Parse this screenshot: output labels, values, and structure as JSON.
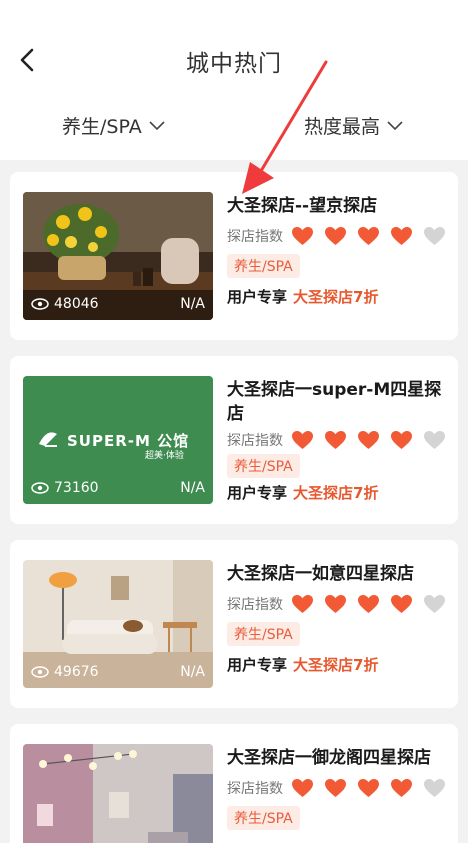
{
  "header": {
    "title": "城中热门"
  },
  "filters": [
    {
      "label": "养生/SPA"
    },
    {
      "label": "热度最高"
    }
  ],
  "colors": {
    "accent": "#f15a35",
    "heart_off": "#d4d4d4",
    "tag_bg": "#fdebe6",
    "brand_green": "#3e8c50"
  },
  "cards": [
    {
      "name": "大圣探店--望京探店",
      "rating_label": "探店指数",
      "rating": 4,
      "max_rating": 5,
      "tag": "养生/SPA",
      "views": "48046",
      "na": "N/A",
      "promo_label": "用户专享",
      "promo_value": "大圣探店7折",
      "image": "flowers-diffuser-photo"
    },
    {
      "name": "大圣探店一super-M四星探店",
      "rating_label": "探店指数",
      "rating": 4,
      "max_rating": 5,
      "tag": "养生/SPA",
      "views": "73160",
      "na": "N/A",
      "promo_label": "用户专享",
      "promo_value": "大圣探店7折",
      "image": "super-m-logo-photo",
      "logo_text": "SUPER-M 公馆",
      "logo_sub": "超美·体验"
    },
    {
      "name": "大圣探店一如意四星探店",
      "rating_label": "探店指数",
      "rating": 4,
      "max_rating": 5,
      "tag": "养生/SPA",
      "views": "49676",
      "na": "N/A",
      "promo_label": "用户专享",
      "promo_value": "大圣探店7折",
      "image": "living-room-photo"
    },
    {
      "name": "大圣探店一御龙阁四星探店",
      "rating_label": "探店指数",
      "rating": 4,
      "max_rating": 5,
      "tag": "养生/SPA",
      "image": "chandelier-room-photo"
    }
  ]
}
